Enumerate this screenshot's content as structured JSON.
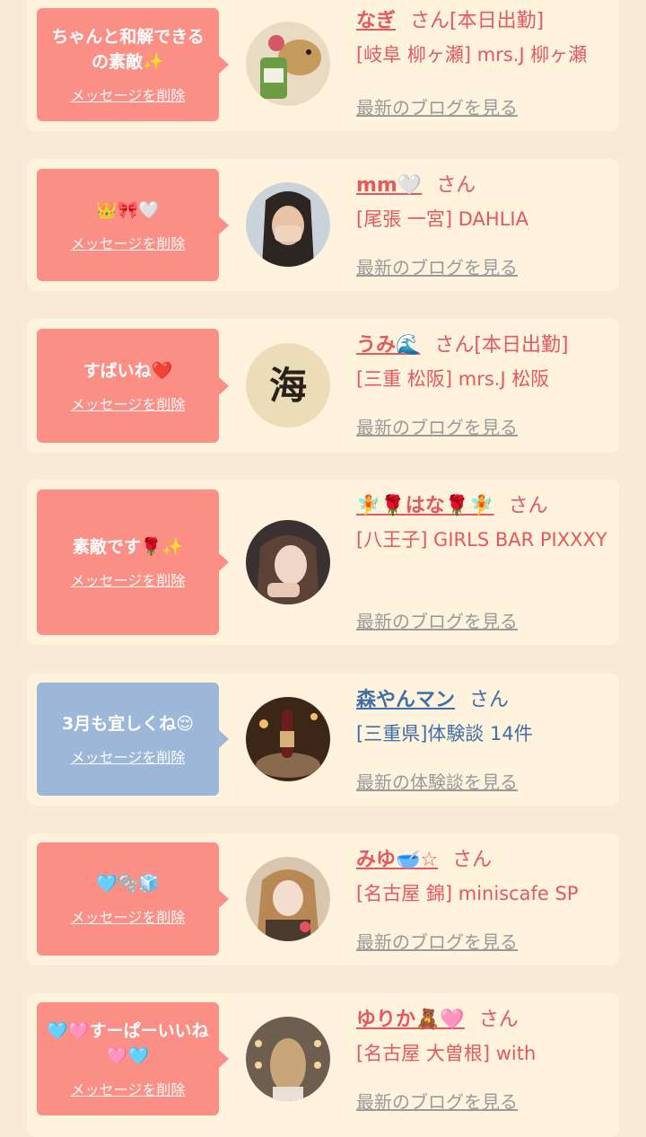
{
  "entries": [
    {
      "message": "ちゃんと和解できるの素敵✨",
      "delete_label": "メッセージを削除",
      "name": "なぎ",
      "san": "さん[本日出勤]",
      "shop": "[岐阜 柳ヶ瀬] mrs.J 柳ヶ瀬",
      "link": "最新のブログを見る",
      "theme": "pink"
    },
    {
      "message": "👑🎀🤍",
      "delete_label": "メッセージを削除",
      "name": "mm🤍",
      "san": "さん",
      "shop": "[尾張 一宮] DAHLIA",
      "link": "最新のブログを見る",
      "theme": "pink"
    },
    {
      "message": "すばいね❤️",
      "delete_label": "メッセージを削除",
      "name": "うみ🌊",
      "san": "さん[本日出勤]",
      "shop": "[三重 松阪] mrs.J 松阪",
      "link": "最新のブログを見る",
      "theme": "pink"
    },
    {
      "message": "素敵です🌹✨",
      "delete_label": "メッセージを削除",
      "name": "🧚🌹はな🌹🧚",
      "san": "さん",
      "shop": "[八王子] GIRLS BAR PIXXXY",
      "link": "最新のブログを見る",
      "theme": "pink"
    },
    {
      "message": "3月も宜しくね😌",
      "delete_label": "メッセージを削除",
      "name": "森やんマン",
      "san": "さん",
      "shop": "[三重県]体験談 14件",
      "link": "最新の体験談を見る",
      "theme": "blue"
    },
    {
      "message": "🩵🫧🧊",
      "delete_label": "メッセージを削除",
      "name": "みゆ🥣☆",
      "san": "さん",
      "shop": "[名古屋 錦] miniscafe SP",
      "link": "最新のブログを見る",
      "theme": "pink"
    },
    {
      "message": "🩵🩷すーぱーいいね🩷🩵",
      "delete_label": "メッセージを削除",
      "name": "ゆりか🧸🩷",
      "san": "さん",
      "shop": "[名古屋 大曽根] with",
      "link": "最新のブログを見る",
      "theme": "pink"
    }
  ],
  "avatar_image": {
    "kanji": "海"
  }
}
